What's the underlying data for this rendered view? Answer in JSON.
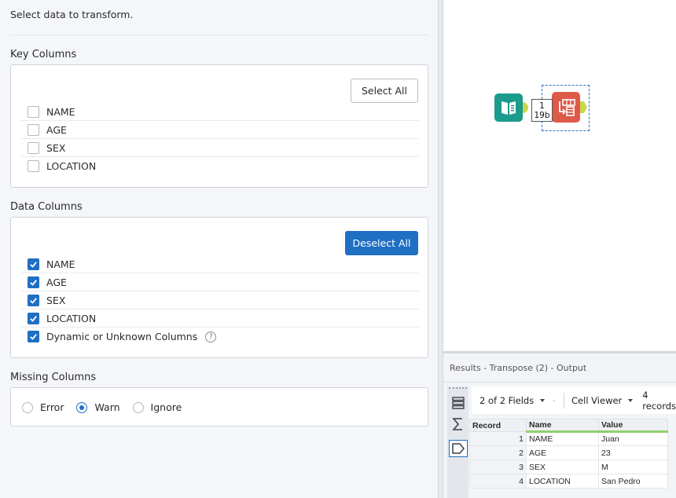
{
  "config": {
    "intro": "Select data to transform.",
    "key_columns": {
      "title": "Key Columns",
      "button_label": "Select All",
      "items": [
        {
          "label": "NAME",
          "checked": false
        },
        {
          "label": "AGE",
          "checked": false
        },
        {
          "label": "SEX",
          "checked": false
        },
        {
          "label": "LOCATION",
          "checked": false
        }
      ]
    },
    "data_columns": {
      "title": "Data Columns",
      "button_label": "Deselect All",
      "items": [
        {
          "label": "NAME",
          "checked": true
        },
        {
          "label": "AGE",
          "checked": true
        },
        {
          "label": "SEX",
          "checked": true
        },
        {
          "label": "LOCATION",
          "checked": true
        },
        {
          "label": "Dynamic or Unknown Columns",
          "checked": true
        }
      ]
    },
    "missing_columns": {
      "title": "Missing Columns",
      "options": [
        {
          "label": "Error",
          "selected": false
        },
        {
          "label": "Warn",
          "selected": true
        },
        {
          "label": "Ignore",
          "selected": false
        }
      ]
    }
  },
  "canvas": {
    "badge_line1": "1",
    "badge_line2": "19b",
    "input_tool_icon": "book-icon",
    "transpose_tool_icon": "transpose-icon"
  },
  "results": {
    "title": "Results - Transpose (2) - Output",
    "fields_label": "2 of 2 Fields",
    "viewer_label": "Cell Viewer",
    "records_label": "4 records",
    "headers": [
      "Record",
      "Name",
      "Value"
    ],
    "rows": [
      [
        "1",
        "NAME",
        "Juan"
      ],
      [
        "2",
        "AGE",
        "23"
      ],
      [
        "3",
        "SEX",
        "M"
      ],
      [
        "4",
        "LOCATION",
        "San Pedro"
      ]
    ]
  },
  "colors": {
    "accent": "#1f6fc4",
    "input_tool": "#1a9b8b",
    "transpose_tool": "#de5a48",
    "anchor": "#c8d84b"
  }
}
